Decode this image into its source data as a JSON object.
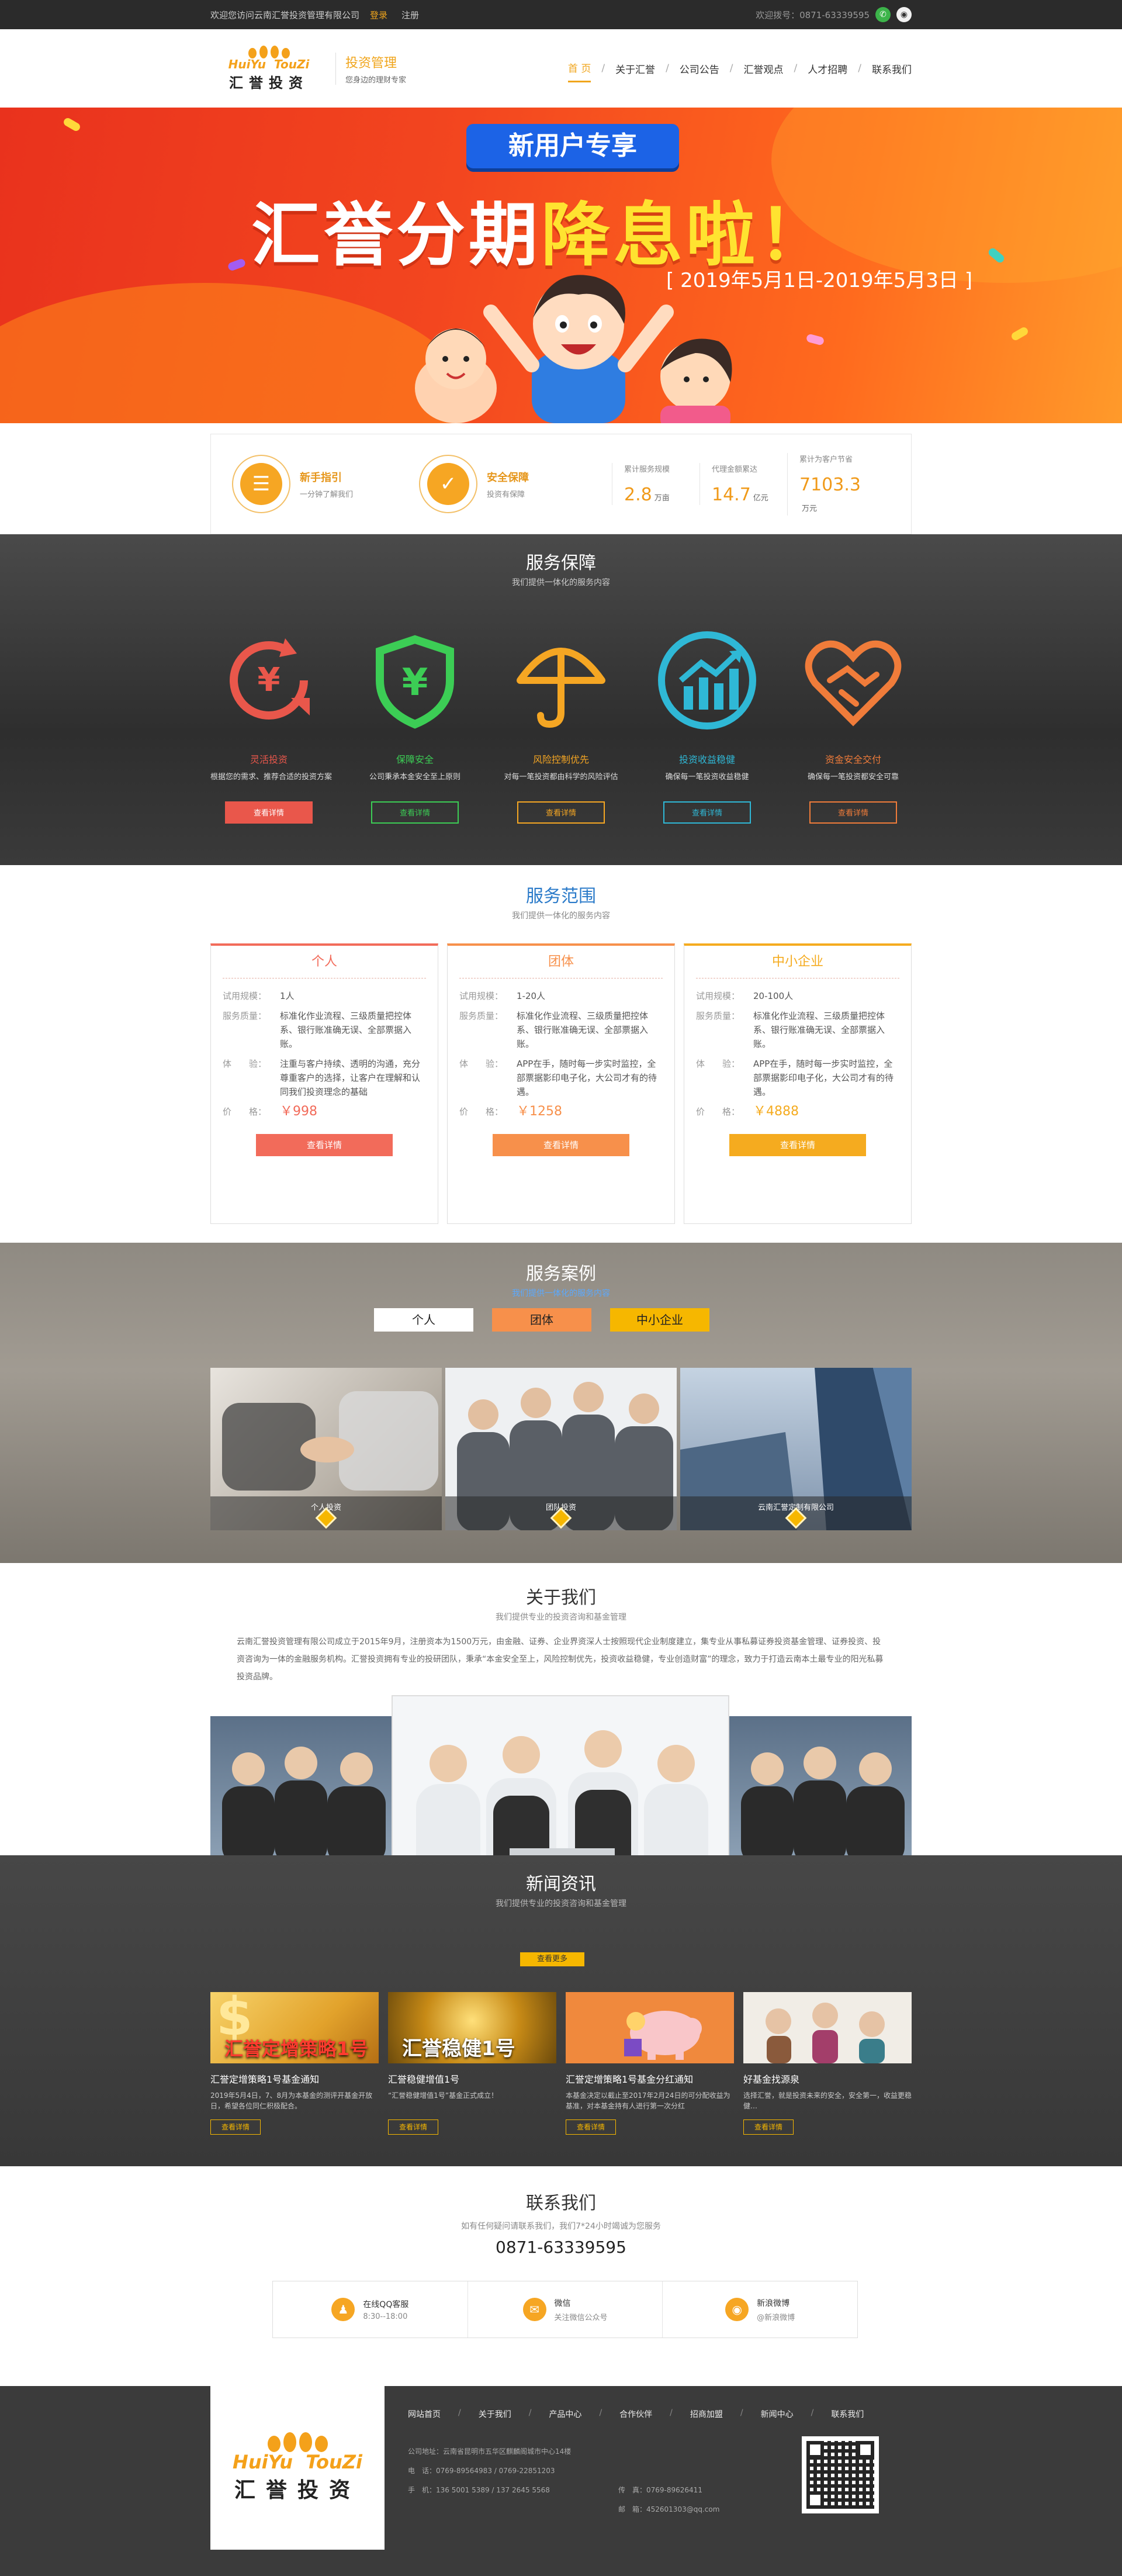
{
  "topbar": {
    "welcome": "欢迎您访问云南汇誉投资管理有限公司",
    "login": "登录",
    "register": "注册",
    "hotline": "欢迎拨号：0871-63339595"
  },
  "header": {
    "logo_en_left": "HuiYu",
    "logo_en_right": "TouZi",
    "logo_cn": "汇誉投资",
    "brand_title": "投资管理",
    "brand_sub": "您身边的理财专家",
    "nav": [
      "首 页",
      "关于汇誉",
      "公司公告",
      "汇誉观点",
      "人才招聘",
      "联系我们"
    ]
  },
  "banner": {
    "tag": "新用户专享",
    "headline_a": "汇誉分期",
    "headline_b": "降息啦！",
    "dates": "[ 2019年5月1日-2019年5月3日 ]"
  },
  "stats": {
    "features": [
      {
        "title": "新手指引",
        "desc": "一分钟了解我们",
        "icon": "document-icon"
      },
      {
        "title": "安全保障",
        "desc": "投资有保障",
        "icon": "shield-check-icon"
      }
    ],
    "items": [
      {
        "label": "累计服务规模",
        "value": "2.8",
        "unit": "万亩"
      },
      {
        "label": "代理金额累达",
        "value": "14.7",
        "unit": "亿元"
      },
      {
        "label": "累计为客户节省",
        "value": "7103.3",
        "unit": "万元"
      }
    ]
  },
  "guarantee": {
    "title": "服务保障",
    "subtitle": "我们提供一体化的服务内容",
    "items": [
      {
        "name": "灵活投资",
        "desc": "根据您的需求、推荐合适的投资方案",
        "btn": "查看详情",
        "color": "#e9574b",
        "icon": "yen-refresh-icon"
      },
      {
        "name": "保障安全",
        "desc": "公司秉承本金安全至上原则",
        "btn": "查看详情",
        "color": "#3ccd55",
        "icon": "yen-shield-icon"
      },
      {
        "name": "风险控制优先",
        "desc": "对每一笔投资都由科学的风险评估",
        "btn": "查看详情",
        "color": "#f5a623",
        "icon": "umbrella-icon"
      },
      {
        "name": "投资收益稳健",
        "desc": "确保每一笔投资收益稳健",
        "btn": "查看详情",
        "color": "#2fb8d6",
        "icon": "growth-chart-icon"
      },
      {
        "name": "资金安全交付",
        "desc": "确保每一笔投资都安全可靠",
        "btn": "查看详情",
        "color": "#f07c3a",
        "icon": "handshake-heart-icon"
      }
    ]
  },
  "scope": {
    "title": "服务范围",
    "subtitle": "我们提供一体化的服务内容",
    "cards": [
      {
        "name": "个人",
        "color": "#f26b5a",
        "rows": [
          {
            "k": "试用规模：",
            "v": "1人"
          },
          {
            "k": "服务质量：",
            "v": "标准化作业流程、三级质量把控体系、银行账准确无误、全部票据入账。"
          },
          {
            "k": "体　　验：",
            "v": "注重与客户持续、透明的沟通，充分尊重客户的选择，让客户在理解和认同我们投资理念的基础"
          }
        ],
        "price_k": "价　　格：",
        "price": "￥998",
        "btn": "查看详情",
        "btn_color": "#f26b5a"
      },
      {
        "name": "团体",
        "color": "#f7904b",
        "rows": [
          {
            "k": "试用规模：",
            "v": "1-20人"
          },
          {
            "k": "服务质量：",
            "v": "标准化作业流程、三级质量把控体系、银行账准确无误、全部票据入账。"
          },
          {
            "k": "体　　验：",
            "v": "APP在手，随时每一步实时监控，全部票据影印电子化，大公司才有的待遇。"
          }
        ],
        "price_k": "价　　格：",
        "price": "￥1258",
        "btn": "查看详情",
        "btn_color": "#f7904b"
      },
      {
        "name": "中小企业",
        "color": "#f5ab1f",
        "rows": [
          {
            "k": "试用规模：",
            "v": "20-100人"
          },
          {
            "k": "服务质量：",
            "v": "标准化作业流程、三级质量把控体系、银行账准确无误、全部票据入账。"
          },
          {
            "k": "体　　验：",
            "v": "APP在手，随时每一步实时监控，全部票据影印电子化，大公司才有的待遇。"
          }
        ],
        "price_k": "价　　格：",
        "price": "￥4888",
        "btn": "查看详情",
        "btn_color": "#f5ab1f"
      }
    ]
  },
  "cases": {
    "title": "服务案例",
    "subtitle": "我们提供一体化的服务内容",
    "tabs": [
      {
        "label": "个人",
        "bg": "#ffffff"
      },
      {
        "label": "团体",
        "bg": "#f7904b"
      },
      {
        "label": "中小企业",
        "bg": "#f6b700"
      }
    ],
    "items": [
      {
        "caption": "个人投资"
      },
      {
        "caption": "团队投资"
      },
      {
        "caption": "云南汇誉定制有限公司"
      }
    ]
  },
  "about": {
    "title": "关于我们",
    "subtitle": "我们提供专业的投资咨询和基金管理",
    "paragraph": "云南汇誉投资管理有限公司成立于2015年9月，注册资本为1500万元，由金融、证券、企业界资深人士按照现代企业制度建立，集专业从事私募证券投资基金管理、证券投资、投资咨询为一体的金融服务机构。汇誉投资拥有专业的投研团队，秉承“本金安全至上，风险控制优先，投资收益稳健，专业创造财富”的理念，致力于打造云南本土最专业的阳光私募投资品牌。"
  },
  "news": {
    "title": "新闻资讯",
    "subtitle": "我们提供专业的投资咨询和基金管理",
    "more": "查看更多",
    "items": [
      {
        "overlay": "汇誉定增策略1号",
        "title": "汇誉定增策略1号基金通知",
        "desc": "2019年5月4日，7、8月为本基金的测评开基金开放日，希望各位同仁积极配合。",
        "btn": "查看详情"
      },
      {
        "overlay": "汇誉稳健1号",
        "title": "汇誉稳健增值1号",
        "desc": "“汇誉稳健增值1号”基金正式成立！",
        "btn": "查看详情"
      },
      {
        "overlay": "",
        "title": "汇誉定增策略1号基金分红通知",
        "desc": "本基金决定以截止至2017年2月24日的可分配收益为基准，对本基金持有人进行第一次分红",
        "btn": "查看详情"
      },
      {
        "overlay": "",
        "title": "好基金找源泉",
        "desc": "选择汇誉，就是投资未来的安全，安全第一，收益更稳健…",
        "btn": "查看详情"
      }
    ]
  },
  "contact": {
    "title": "联系我们",
    "sub": "如有任何疑问请联系我们，我们7*24小时竭诚为您服务",
    "phone": "0871-63339595",
    "boxes": [
      {
        "l1": "在线QQ客服",
        "l2": "8:30--18:00",
        "icon": "qq-penguin-icon",
        "color": "#f6a623"
      },
      {
        "l1": "微信",
        "l2": "关注微信公众号",
        "icon": "wechat-icon",
        "color": "#f6a623"
      },
      {
        "l1": "新浪微博",
        "l2": "@新浪微博",
        "icon": "weibo-icon",
        "color": "#f6a623"
      }
    ]
  },
  "footer": {
    "nav": [
      "网站首页",
      "关于我们",
      "产品中心",
      "合作伙伴",
      "招商加盟",
      "新闻中心",
      "联系我们"
    ],
    "info": [
      {
        "c1": "公司地址：云南省昆明市五华区麒麟阁城市中心14楼",
        "c2": ""
      },
      {
        "c1": "电　话：0769-89564983 / 0769-22851203",
        "c2": ""
      },
      {
        "c1": "手　机：136 5001 5389 / 137 2645 5568",
        "c2": "传　真：0769-89626411"
      },
      {
        "c1": "",
        "c2": "邮　箱：452601303@qq.com"
      }
    ]
  }
}
